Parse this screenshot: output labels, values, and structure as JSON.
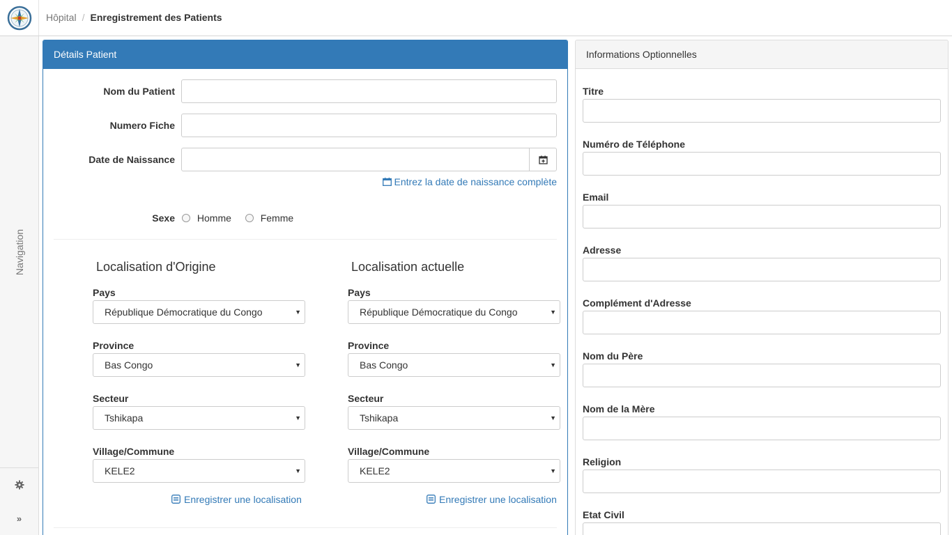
{
  "breadcrumb": {
    "root": "Hôpital",
    "separator": "/",
    "current": "Enregistrement des Patients"
  },
  "sidebar": {
    "nav_label": "Navigation"
  },
  "patient_panel": {
    "title": "Détails Patient",
    "name_label": "Nom du Patient",
    "name_value": "",
    "file_label": "Numero Fiche",
    "file_value": "",
    "dob_label": "Date de Naissance",
    "dob_value": "",
    "dob_full_link": "Entrez la date de naissance complète",
    "sex_label": "Sexe",
    "sex_male": "Homme",
    "sex_female": "Femme"
  },
  "origin": {
    "title": "Localisation d'Origine",
    "country_label": "Pays",
    "country_value": "République Démocratique du Congo",
    "province_label": "Province",
    "province_value": "Bas Congo",
    "sector_label": "Secteur",
    "sector_value": "Tshikapa",
    "village_label": "Village/Commune",
    "village_value": "KELE2",
    "register_link": "Enregistrer une localisation"
  },
  "current": {
    "title": "Localisation actuelle",
    "country_label": "Pays",
    "country_value": "République Démocratique du Congo",
    "province_label": "Province",
    "province_value": "Bas Congo",
    "sector_label": "Secteur",
    "sector_value": "Tshikapa",
    "village_label": "Village/Commune",
    "village_value": "KELE2",
    "register_link": "Enregistrer une localisation"
  },
  "optional_panel": {
    "title": "Informations Optionnelles",
    "title_label": "Titre",
    "phone_label": "Numéro de Téléphone",
    "email_label": "Email",
    "address_label": "Adresse",
    "address2_label": "Complément d'Adresse",
    "father_label": "Nom du Père",
    "mother_label": "Nom de la Mère",
    "religion_label": "Religion",
    "civil_label": "Etat Civil"
  },
  "colors": {
    "primary": "#337ab7",
    "border": "#cccccc"
  }
}
